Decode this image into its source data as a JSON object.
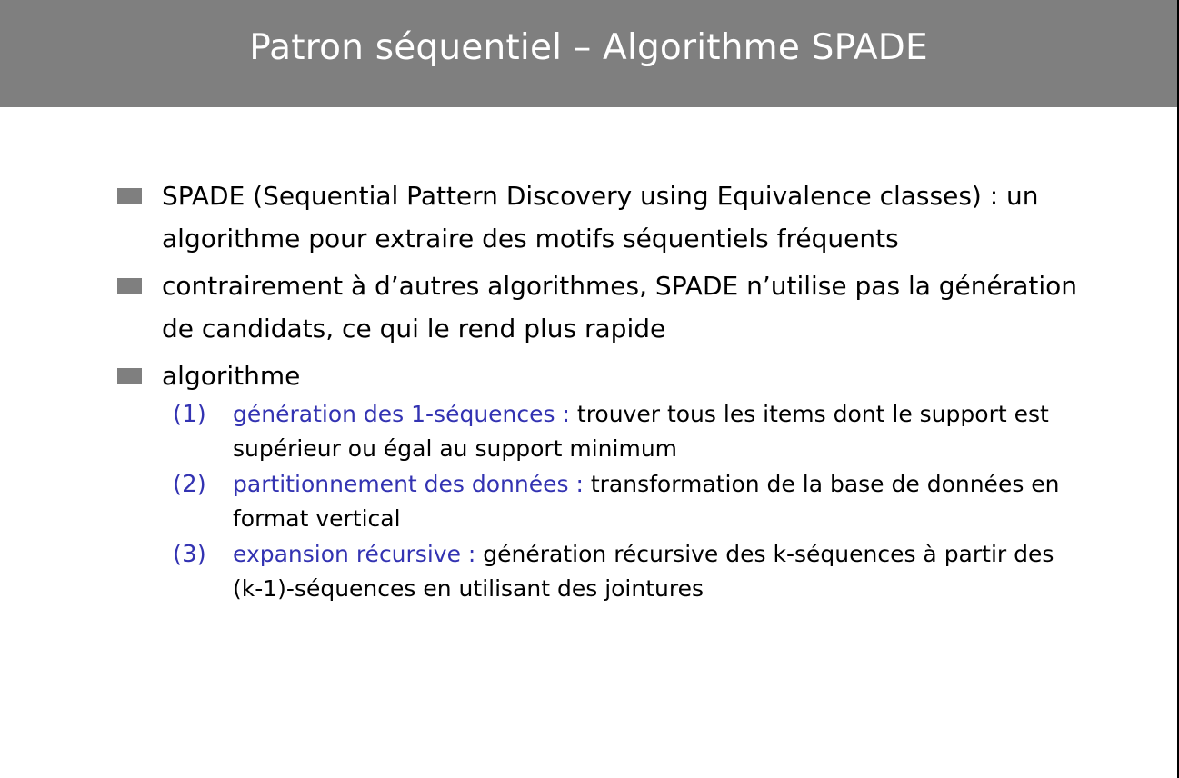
{
  "slide": {
    "title": "Patron séquentiel – Algorithme SPADE",
    "colors": {
      "title_bar": "#7f7f7f",
      "title_text": "#ffffff",
      "bullet": "#7f7f7f",
      "accent": "#3333b2"
    },
    "bullets": [
      {
        "text": "SPADE (Sequential Pattern Discovery using Equivalence classes) : un algorithme pour extraire des motifs séquentiels fréquents"
      },
      {
        "text": "contrairement à d’autres algorithmes, SPADE n’utilise pas la génération de candidats, ce qui le rend plus rapide"
      },
      {
        "text": "algorithme"
      }
    ],
    "steps": [
      {
        "number": "(1)",
        "term": "génération des 1-séquences :",
        "text": "trouver tous les items dont le support est supérieur ou égal au support minimum"
      },
      {
        "number": "(2)",
        "term": "partitionnement des données :",
        "text": "transformation de la base de données en format vertical"
      },
      {
        "number": "(3)",
        "term": "expansion récursive :",
        "text": "génération récursive des k-séquences à partir des (k-1)-séquences en utilisant des jointures"
      }
    ]
  }
}
